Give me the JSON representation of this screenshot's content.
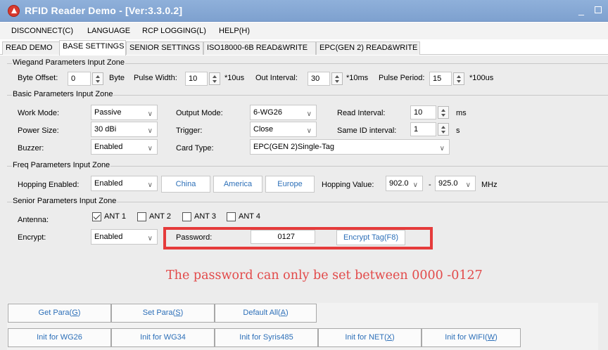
{
  "window": {
    "title": "RFID Reader Demo - [Ver:3.3.0.2]"
  },
  "menu": [
    "DISCONNECT(C)",
    "LANGUAGE",
    "RCP LOGGING(L)",
    "HELP(H)"
  ],
  "tabs": [
    "READ DEMO",
    "BASE SETTINGS",
    "SENIOR SETTINGS",
    "ISO18000-6B READ&WRITE",
    "EPC(GEN 2) READ&WRITE"
  ],
  "active_tab": "BASE SETTINGS",
  "wiegand": {
    "title": "Wiegand Parameters Input Zone",
    "byte_offset_label": "Byte Offset:",
    "byte_offset_value": "0",
    "byte_unit": "Byte",
    "pulse_width_label": "Pulse Width:",
    "pulse_width_value": "10",
    "pulse_width_unit": "*10us",
    "out_interval_label": "Out Interval:",
    "out_interval_value": "30",
    "out_interval_unit": "*10ms",
    "pulse_period_label": "Pulse Period:",
    "pulse_period_value": "15",
    "pulse_period_unit": "*100us"
  },
  "basic": {
    "title": "Basic Parameters Input Zone",
    "work_mode_label": "Work Mode:",
    "work_mode_value": "Passive",
    "output_mode_label": "Output Mode:",
    "output_mode_value": "6-WG26",
    "read_interval_label": "Read Interval:",
    "read_interval_value": "10",
    "read_interval_unit": "ms",
    "power_size_label": "Power Size:",
    "power_size_value": "30 dBi",
    "trigger_label": "Trigger:",
    "trigger_value": "Close",
    "same_id_label": "Same ID interval:",
    "same_id_value": "1",
    "same_id_unit": "s",
    "buzzer_label": "Buzzer:",
    "buzzer_value": "Enabled",
    "card_type_label": "Card Type:",
    "card_type_value": "EPC(GEN 2)Single-Tag"
  },
  "freq": {
    "title": "Freq Parameters Input Zone",
    "hopping_enabled_label": "Hopping Enabled:",
    "hopping_enabled_value": "Enabled",
    "china_label": "China",
    "america_label": "America",
    "europe_label": "Europe",
    "hopping_value_label": "Hopping Value:",
    "hop_from": "902.0",
    "hop_dash": "-",
    "hop_to": "925.0",
    "hop_unit": "MHz"
  },
  "senior": {
    "title": "Senior Parameters Input Zone",
    "antenna_label": "Antenna:",
    "antennas": [
      {
        "label": "ANT 1",
        "checked": true
      },
      {
        "label": "ANT 2",
        "checked": false
      },
      {
        "label": "ANT 3",
        "checked": false
      },
      {
        "label": "ANT 4",
        "checked": false
      }
    ],
    "encrypt_label": "Encrypt:",
    "encrypt_value": "Enabled",
    "password_label": "Password:",
    "password_value": "0127",
    "encrypt_tag_label": "Encrypt Tag(F8)"
  },
  "notice": "The password can only be set between 0000 -0127",
  "buttons_row1": [
    {
      "text": "Get Para(",
      "key": "G"
    },
    {
      "text": "Set Para(",
      "key": "S"
    },
    {
      "text": "Default All(",
      "key": "A"
    }
  ],
  "buttons_row2": [
    {
      "text": "Init for WG26"
    },
    {
      "text": "Init for WG34"
    },
    {
      "text": "Init for Syris485"
    },
    {
      "text": "Init for NET(",
      "key": "X"
    },
    {
      "text": "Init for WIFI(",
      "key": "W"
    }
  ],
  "colors": {
    "titlebar": "#7ea1cf",
    "accent_text": "#2c6fb8",
    "highlight": "#e53b3b",
    "notice": "#e24a4a",
    "panel": "#ececec"
  }
}
